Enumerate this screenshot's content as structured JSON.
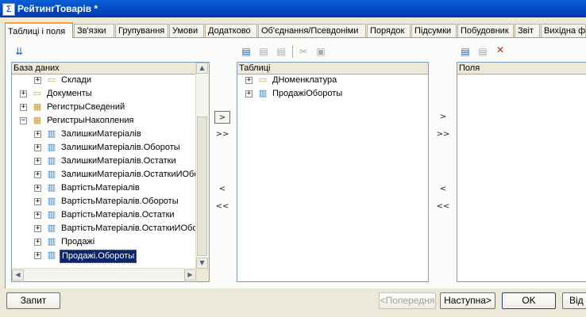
{
  "window": {
    "title": "РейтингТоварів *"
  },
  "tabs": [
    "Таблиці і поля",
    "Зв'язки",
    "Групування",
    "Умови",
    "Додатково",
    "Об'єднання/Псевдоніми",
    "Порядок",
    "Підсумки",
    "Побудовник",
    "Звіт",
    "Вихідна ф"
  ],
  "active_tab": "Таблиці і поля",
  "database_panel": {
    "header": "База даних",
    "items": [
      {
        "label": "Склади",
        "icon": "folder-icon",
        "level": 2
      },
      {
        "label": "Документы",
        "icon": "folder-icon",
        "level": 1
      },
      {
        "label": "РегистрыСведений",
        "icon": "information-registers-icon",
        "level": 1
      },
      {
        "label": "РегистрыНакопления",
        "icon": "accumulation-registers-icon",
        "level": 1,
        "expanded": true
      },
      {
        "label": "ЗалишкиМатеріалів",
        "icon": "register-icon",
        "level": 2
      },
      {
        "label": "ЗалишкиМатеріалів.Обороты",
        "icon": "register-icon",
        "level": 2
      },
      {
        "label": "ЗалишкиМатеріалів.Остатки",
        "icon": "register-icon",
        "level": 2
      },
      {
        "label": "ЗалишкиМатеріалів.ОстаткиИОбо",
        "icon": "register-icon",
        "level": 2
      },
      {
        "label": "ВартістьМатеріалів",
        "icon": "register-icon",
        "level": 2
      },
      {
        "label": "ВартістьМатеріалів.Обороты",
        "icon": "register-icon",
        "level": 2
      },
      {
        "label": "ВартістьМатеріалів.Остатки",
        "icon": "register-icon",
        "level": 2
      },
      {
        "label": "ВартістьМатеріалів.ОстаткиИОбор",
        "icon": "register-icon",
        "level": 2
      },
      {
        "label": "Продажі",
        "icon": "register-icon",
        "level": 2
      },
      {
        "label": "Продажі.Обороты",
        "icon": "register-icon",
        "level": 2,
        "selected": true
      }
    ]
  },
  "tables_panel": {
    "header": "Таблиці",
    "items": [
      {
        "label": "ДНоменклатура",
        "icon": "folder-icon"
      },
      {
        "label": "ПродажіОбороты",
        "icon": "register-icon"
      }
    ]
  },
  "fields_panel": {
    "header": "Поля"
  },
  "move_buttons": {
    "add": ">",
    "add_all": ">>",
    "remove": "<",
    "remove_all": "<<"
  },
  "footer": {
    "query": "Запит",
    "back": "<Попередня",
    "next": "Наступна>",
    "ok": "OK",
    "cancel": "Від"
  },
  "icons": {
    "app": "Σ",
    "expand": "+",
    "collapse": "−"
  },
  "colors": {
    "selection": "#0a246a",
    "titlebar": "#0046c4",
    "active_tab_accent": "#f7a531"
  }
}
